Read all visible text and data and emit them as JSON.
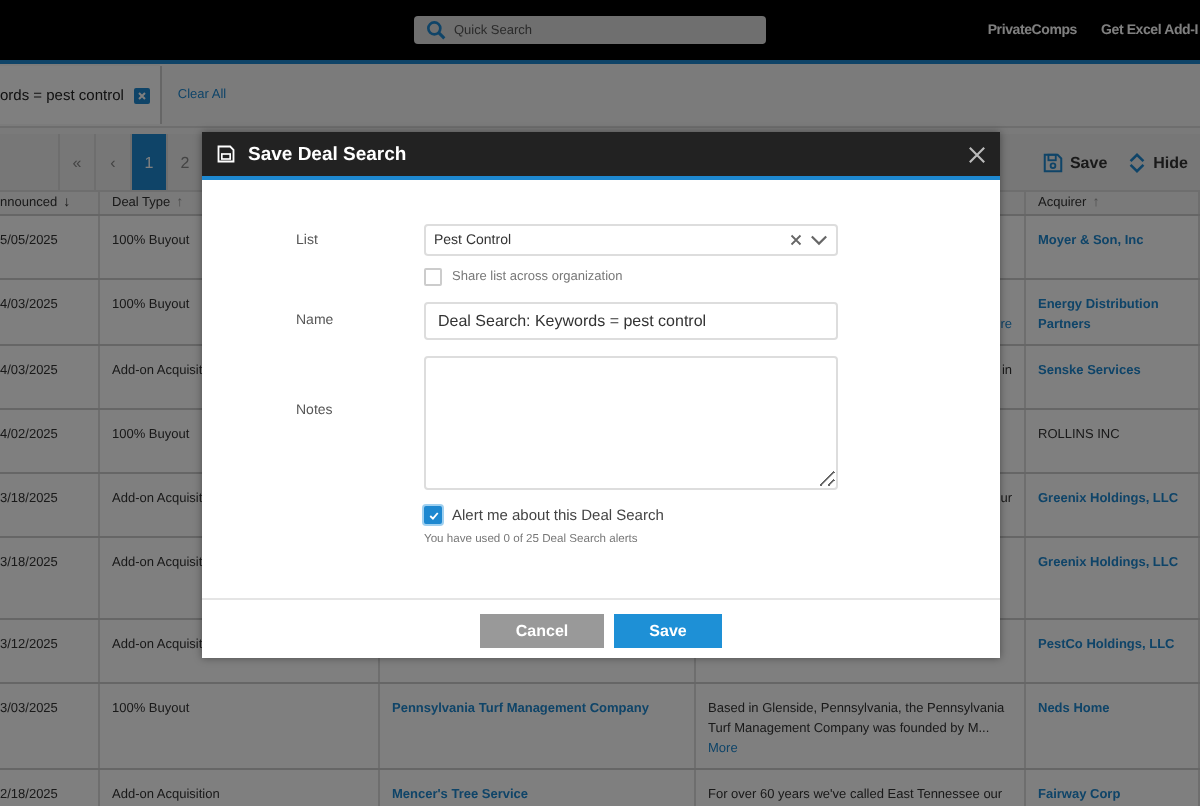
{
  "top_bar": {
    "search": {
      "placeholder": "Quick Search"
    },
    "links": [
      "PrivateComps",
      "Get Excel Add-I"
    ]
  },
  "filters": {
    "chip": "ords = pest control",
    "clear": "Clear All"
  },
  "pagination": [
    {
      "label": "«",
      "selected": false
    },
    {
      "label": "‹",
      "selected": false
    },
    {
      "label": "1",
      "selected": true
    },
    {
      "label": "2",
      "selected": false
    }
  ],
  "toolbar": [
    {
      "kind": "save",
      "label": "Save"
    },
    {
      "kind": "hide",
      "label": "Hide"
    }
  ],
  "table": {
    "header": {
      "announced": {
        "label": "nnounced",
        "sort_icon": "↓"
      },
      "deal_type": {
        "label": "Deal Type",
        "sort_icon": "↑"
      },
      "acquirer": {
        "label": "Acquirer",
        "sort_icon": "↑"
      }
    },
    "rows": [
      {
        "announced": "5/05/2025",
        "deal_type": "100% Buyout",
        "acquirer": "Moyer & Son, Inc",
        "acquirer_link": true
      },
      {
        "announced": "4/03/2025",
        "deal_type": "100% Buyout",
        "more": "re",
        "acquirer": "Energy Distribution Partners",
        "acquirer_link": true
      },
      {
        "announced": "4/03/2025",
        "deal_type": "Add-on Acquisit",
        "description": "in",
        "acquirer": "Senske Services",
        "acquirer_link": true
      },
      {
        "announced": "4/02/2025",
        "deal_type": "100% Buyout",
        "acquirer": "ROLLINS INC",
        "acquirer_link": false
      },
      {
        "announced": "3/18/2025",
        "deal_type": "Add-on Acquisit",
        "description": "ur",
        "acquirer": "Greenix Holdings, LLC",
        "acquirer_link": true
      },
      {
        "announced": "3/18/2025",
        "deal_type": "Add-on Acquisit",
        "acquirer": "Greenix Holdings, LLC",
        "acquirer_link": true
      },
      {
        "announced": "3/12/2025",
        "deal_type": "Add-on Acquisit",
        "acquirer": "PestCo Holdings, LLC",
        "acquirer_link": true
      },
      {
        "announced": "3/03/2025",
        "deal_type": "100% Buyout",
        "target": "Pennsylvania Turf Management Company",
        "description": "Based in Glenside, Pennsylvania, the Pennsylvania Turf Management Company was founded by M...",
        "more": "More",
        "acquirer": "Neds Home",
        "acquirer_link": true
      },
      {
        "announced": "2/18/2025",
        "deal_type": "Add-on Acquisition",
        "target": "Mencer's Tree Service",
        "description": "For over 60 years we've called East Tennessee our",
        "acquirer": "Fairway Corp",
        "acquirer_link": true
      }
    ]
  },
  "dialog": {
    "title": "Save Deal Search",
    "list": {
      "label": "List",
      "value": "Pest Control"
    },
    "share": {
      "label": "Share list across organization",
      "checked": false
    },
    "name": {
      "label": "Name",
      "value": "Deal Search: Keywords = pest control"
    },
    "notes": {
      "label": "Notes"
    },
    "alert": {
      "label": "Alert me about this Deal Search",
      "checked": true
    },
    "hint": "You have used 0 of 25 Deal Search alerts",
    "buttons": [
      {
        "kind": "secondary",
        "label": "Cancel"
      },
      {
        "kind": "primary",
        "label": "Save"
      }
    ]
  }
}
